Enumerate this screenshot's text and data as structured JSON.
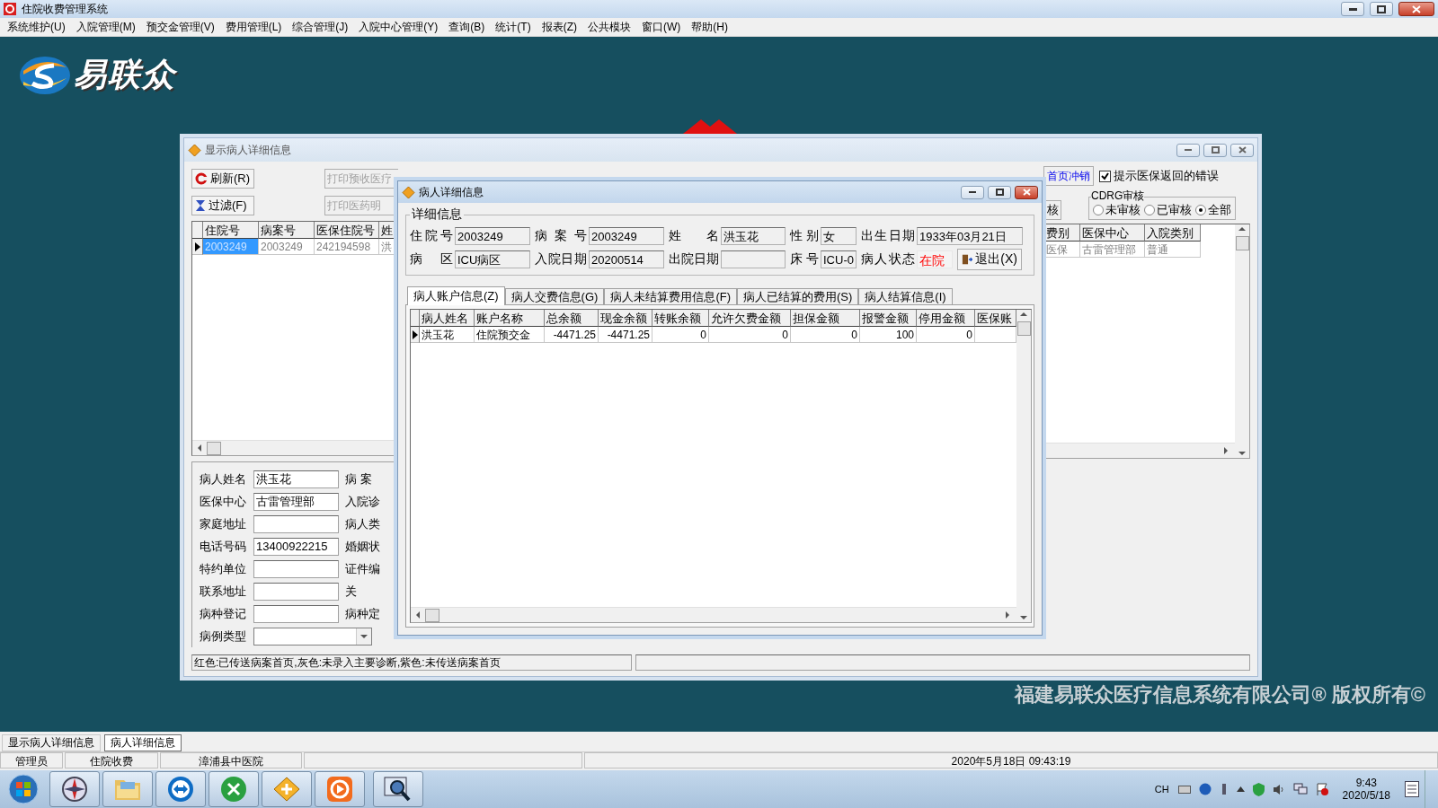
{
  "window": {
    "title": "住院收费管理系统"
  },
  "menu": [
    "系统维护(U)",
    "入院管理(M)",
    "预交金管理(V)",
    "费用管理(L)",
    "综合管理(J)",
    "入院中心管理(Y)",
    "查询(B)",
    "统计(T)",
    "报表(Z)",
    "公共模块",
    "窗口(W)",
    "帮助(H)"
  ],
  "logo": {
    "text": "易联众"
  },
  "copyright": "福建易联众医疗信息系统有限公司® 版权所有©",
  "patient_list": {
    "title": "显示病人详细信息",
    "toolbar": [
      {
        "label": "刷新(R)",
        "kind": "refresh"
      },
      {
        "label": "过滤(F)",
        "kind": "filter"
      }
    ],
    "print_buttons": [
      {
        "label": "打印预收医疗",
        "disabled": true
      },
      {
        "label": "打印医药明",
        "disabled": true
      }
    ],
    "link_button": "首页冲销",
    "audit_button": "核",
    "show_errors": {
      "label": "提示医保返回的错误",
      "checked": true
    },
    "cdrg": {
      "title": "CDRG审核",
      "options": [
        {
          "label": "未审核",
          "selected": false
        },
        {
          "label": "已审核",
          "selected": false
        },
        {
          "label": "全部",
          "selected": true
        }
      ]
    },
    "grid_left": {
      "columns": [
        "住院号",
        "病案号",
        "医保住院号",
        "姓"
      ],
      "rows": [
        {
          "selected": true,
          "color": "#808080",
          "cells": [
            "2003249",
            "2003249",
            "242194598",
            "洪"
          ]
        }
      ]
    },
    "grid_right": {
      "columns": [
        "费别",
        "医保中心",
        "入院类别"
      ],
      "rows": [
        {
          "color": "#808080",
          "cells": [
            "医保",
            "古雷管理部",
            "普通"
          ]
        }
      ]
    },
    "form": [
      {
        "label": "病人姓名",
        "value": "洪玉花",
        "kind": "text",
        "label_2": "病 案"
      },
      {
        "label": "医保中心",
        "value": "古雷管理部",
        "kind": "text",
        "label_2": "入院诊"
      },
      {
        "label": "家庭地址",
        "kind": "text",
        "label_2": "病人类"
      },
      {
        "label": "电话号码",
        "value": "13400922215",
        "kind": "text",
        "label_2": "婚姻状"
      },
      {
        "label": "特约单位",
        "kind": "text",
        "label_2": "证件编"
      },
      {
        "label": "联系地址",
        "kind": "text",
        "label_2": "关"
      },
      {
        "label": "病种登记",
        "kind": "text",
        "label_2": "病种定"
      },
      {
        "label": "病例类型",
        "kind": "combo"
      }
    ],
    "legend": "红色:已传送病案首页,灰色:未录入主要诊断,紫色:未传送病案首页"
  },
  "detail": {
    "title": "病人详细信息",
    "group_title": "详细信息",
    "fields": [
      {
        "label": "住院号",
        "value": "2003249",
        "alert": false
      },
      {
        "label": "病 案 号",
        "value": "2003249",
        "alert": false
      },
      {
        "label": "姓 名",
        "value": "洪玉花",
        "alert": false
      },
      {
        "label": "性别",
        "value": "女",
        "alert": false
      },
      {
        "label": "出生日期",
        "value": "1933年03月21日",
        "alert": false
      },
      {
        "label": "病 区",
        "value": "ICU病区",
        "alert": false
      },
      {
        "label": "入院日期",
        "value": "20200514",
        "alert": false
      },
      {
        "label": "出院日期",
        "alert": false
      },
      {
        "label": "床号",
        "value": "ICU-0",
        "alert": false
      },
      {
        "label": "病人状态",
        "value": "在院",
        "alert": true
      }
    ],
    "exit_button": "退出(X)",
    "tabs": [
      {
        "label": "病人账户信息(Z)",
        "selected": true
      },
      {
        "label": "病人交费信息(G)",
        "selected": false
      },
      {
        "label": "病人未结算费用信息(F)",
        "selected": false
      },
      {
        "label": "病人已结算的费用(S)",
        "selected": false
      },
      {
        "label": "病人结算信息(I)",
        "selected": false
      }
    ],
    "grid": {
      "columns": [
        {
          "label": "病人姓名",
          "kind": "text"
        },
        {
          "label": "账户名称",
          "kind": "text"
        },
        {
          "label": "总余额",
          "kind": "amount"
        },
        {
          "label": "现金余额",
          "kind": "amount"
        },
        {
          "label": "转账余额",
          "kind": "amount"
        },
        {
          "label": "允许欠费金额",
          "kind": "amount"
        },
        {
          "label": "担保金额",
          "kind": "amount"
        },
        {
          "label": "报警金额",
          "kind": "amount"
        },
        {
          "label": "停用金额",
          "kind": "amount"
        },
        {
          "label": "医保账",
          "kind": "text"
        }
      ],
      "rows": [
        {
          "selected": true,
          "cells": [
            "洪玉花",
            "住院预交金",
            "-4471.25",
            "-4471.25",
            "0",
            "0",
            "0",
            "100",
            "0"
          ]
        }
      ]
    }
  },
  "mdi_tabs": [
    {
      "label": "显示病人详细信息",
      "selected": false
    },
    {
      "label": "病人详细信息",
      "selected": true
    }
  ],
  "status_bar": [
    "管理员",
    "住院收费",
    "漳浦县中医院",
    "2020年5月18日 09:43:19"
  ],
  "tray": {
    "input_language": "CH",
    "time": "9:43",
    "date": "2020/5/18"
  }
}
